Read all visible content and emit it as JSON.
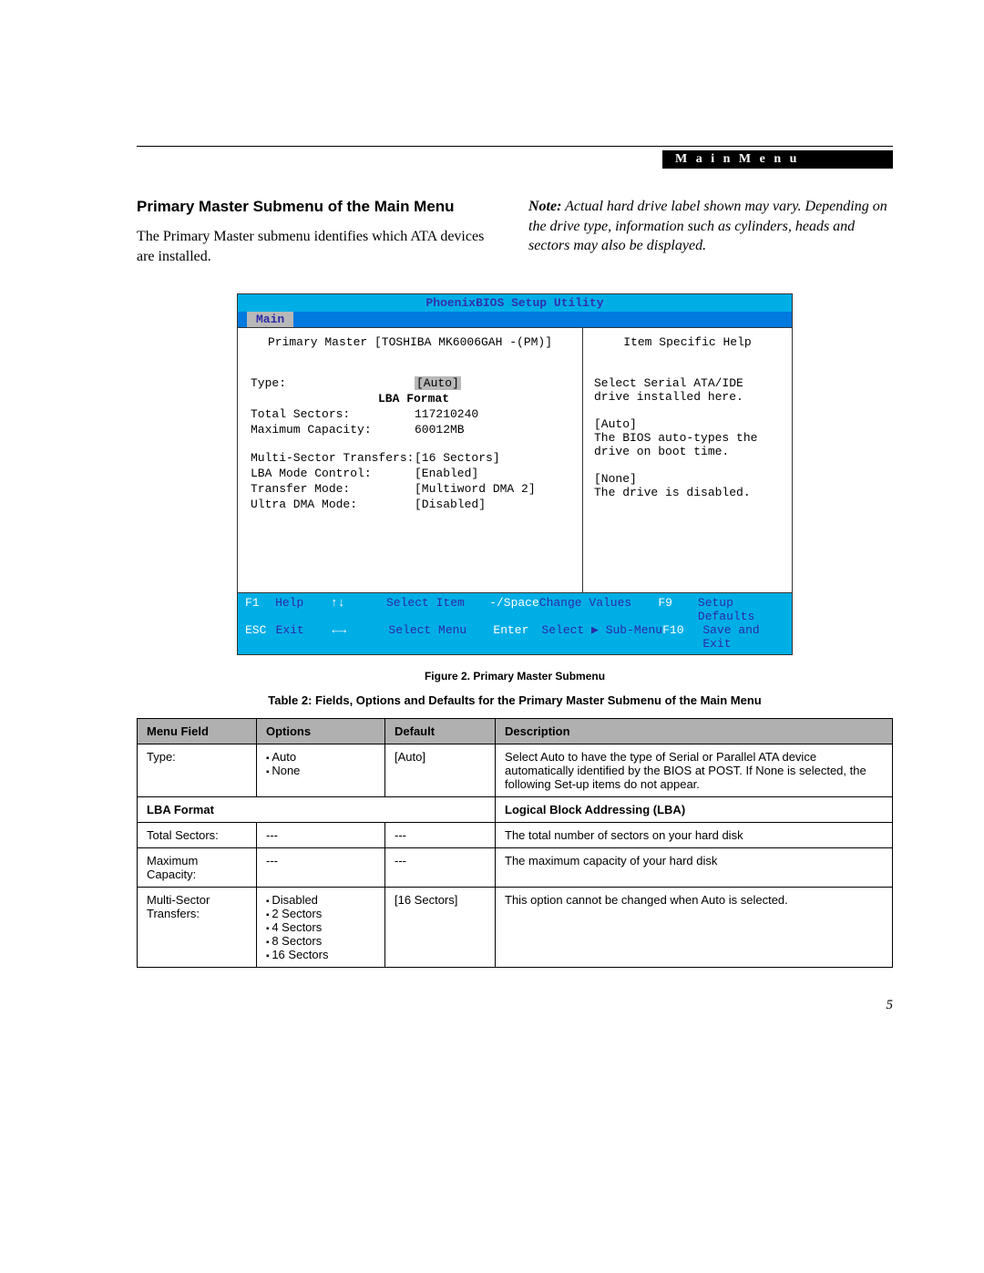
{
  "header_tag": "M a i n   M e n u",
  "section_title": "Primary Master Submenu of the Main Menu",
  "intro_text": "The Primary Master submenu identifies which ATA devices are installed.",
  "note_label": "Note:",
  "note_text": " Actual hard drive label shown may vary. Depending on the drive type, information such as cylinders, heads and sectors may also be displayed.",
  "bios": {
    "title": "PhoenixBIOS Setup Utility",
    "tab": "Main",
    "left_header": "Primary Master [TOSHIBA MK6006GAH -(PM)]",
    "rows": [
      {
        "k": "Type:",
        "v": "[Auto]",
        "hl": true
      },
      {
        "sub": "LBA Format"
      },
      {
        "k": "Total Sectors:",
        "v": "117210240"
      },
      {
        "k": "Maximum Capacity:",
        "v": "60012MB"
      },
      {
        "spacer": true
      },
      {
        "k": "Multi-Sector Transfers:",
        "v": "[16 Sectors]"
      },
      {
        "k": "LBA Mode Control:",
        "v": "[Enabled]"
      },
      {
        "k": "Transfer Mode:",
        "v": "[Multiword DMA 2]"
      },
      {
        "k": "Ultra DMA Mode:",
        "v": "[Disabled]"
      }
    ],
    "help_header": "Item Specific Help",
    "help_lines": [
      "Select Serial ATA/IDE",
      "drive installed here.",
      "",
      "[Auto]",
      "The BIOS auto-types the",
      "drive on boot time.",
      "",
      "[None]",
      "The drive is disabled."
    ],
    "footer": {
      "r1": {
        "fkey": "F1",
        "lbl": "Help",
        "arr": "↑↓",
        "act": "Select Item",
        "sp": "-/Space",
        "spact": "Change Values",
        "fn": "F9",
        "fact": "Setup Defaults"
      },
      "r2": {
        "fkey": "ESC",
        "lbl": "Exit",
        "arr": "←→",
        "act": "Select Menu",
        "sp": "Enter",
        "spact": "Select ▶ Sub-Menu",
        "fn": "F10",
        "fact": "Save and Exit"
      }
    }
  },
  "figure_caption": "Figure 2.   Primary Master Submenu",
  "table_caption": "Table 2: Fields, Options and Defaults for the Primary Master Submenu of the Main Menu",
  "table": {
    "headers": [
      "Menu Field",
      "Options",
      "Default",
      "Description"
    ],
    "rows": [
      {
        "field": "Type:",
        "options": [
          "Auto",
          "None"
        ],
        "default": "[Auto]",
        "desc": "Select Auto to have the type of Serial or Parallel ATA device automatically identified by the BIOS at POST. If None is selected, the following Set-up items do not appear."
      }
    ],
    "section": {
      "label": "LBA Format",
      "desc": "Logical Block Addressing (LBA)"
    },
    "rows2": [
      {
        "field": "Total Sectors:",
        "options_text": "---",
        "default": "---",
        "desc": "The total number of sectors on your hard disk"
      },
      {
        "field": "Maximum Capacity:",
        "options_text": "---",
        "default": "---",
        "desc": "The maximum capacity of your hard disk"
      },
      {
        "field": "Multi-Sector Transfers:",
        "options": [
          "Disabled",
          "2 Sectors",
          "4 Sectors",
          "8 Sectors",
          "16 Sectors"
        ],
        "default": "[16 Sectors]",
        "desc": "This option cannot be changed when Auto is selected."
      }
    ]
  },
  "page_number": "5"
}
